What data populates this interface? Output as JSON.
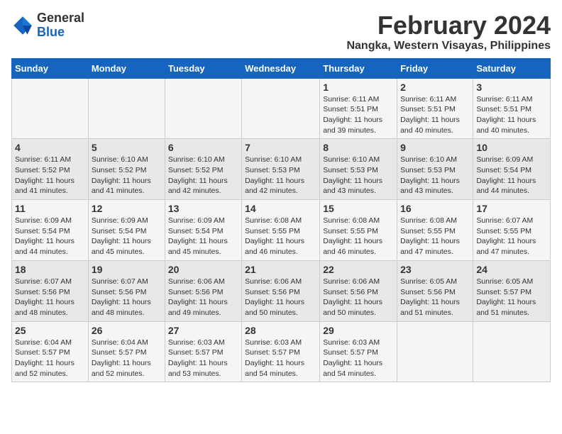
{
  "logo": {
    "general": "General",
    "blue": "Blue"
  },
  "header": {
    "title": "February 2024",
    "location": "Nangka, Western Visayas, Philippines"
  },
  "days_of_week": [
    "Sunday",
    "Monday",
    "Tuesday",
    "Wednesday",
    "Thursday",
    "Friday",
    "Saturday"
  ],
  "weeks": [
    [
      {
        "day": "",
        "info": ""
      },
      {
        "day": "",
        "info": ""
      },
      {
        "day": "",
        "info": ""
      },
      {
        "day": "",
        "info": ""
      },
      {
        "day": "1",
        "info": "Sunrise: 6:11 AM\nSunset: 5:51 PM\nDaylight: 11 hours and 39 minutes."
      },
      {
        "day": "2",
        "info": "Sunrise: 6:11 AM\nSunset: 5:51 PM\nDaylight: 11 hours and 40 minutes."
      },
      {
        "day": "3",
        "info": "Sunrise: 6:11 AM\nSunset: 5:51 PM\nDaylight: 11 hours and 40 minutes."
      }
    ],
    [
      {
        "day": "4",
        "info": "Sunrise: 6:11 AM\nSunset: 5:52 PM\nDaylight: 11 hours and 41 minutes."
      },
      {
        "day": "5",
        "info": "Sunrise: 6:10 AM\nSunset: 5:52 PM\nDaylight: 11 hours and 41 minutes."
      },
      {
        "day": "6",
        "info": "Sunrise: 6:10 AM\nSunset: 5:52 PM\nDaylight: 11 hours and 42 minutes."
      },
      {
        "day": "7",
        "info": "Sunrise: 6:10 AM\nSunset: 5:53 PM\nDaylight: 11 hours and 42 minutes."
      },
      {
        "day": "8",
        "info": "Sunrise: 6:10 AM\nSunset: 5:53 PM\nDaylight: 11 hours and 43 minutes."
      },
      {
        "day": "9",
        "info": "Sunrise: 6:10 AM\nSunset: 5:53 PM\nDaylight: 11 hours and 43 minutes."
      },
      {
        "day": "10",
        "info": "Sunrise: 6:09 AM\nSunset: 5:54 PM\nDaylight: 11 hours and 44 minutes."
      }
    ],
    [
      {
        "day": "11",
        "info": "Sunrise: 6:09 AM\nSunset: 5:54 PM\nDaylight: 11 hours and 44 minutes."
      },
      {
        "day": "12",
        "info": "Sunrise: 6:09 AM\nSunset: 5:54 PM\nDaylight: 11 hours and 45 minutes."
      },
      {
        "day": "13",
        "info": "Sunrise: 6:09 AM\nSunset: 5:54 PM\nDaylight: 11 hours and 45 minutes."
      },
      {
        "day": "14",
        "info": "Sunrise: 6:08 AM\nSunset: 5:55 PM\nDaylight: 11 hours and 46 minutes."
      },
      {
        "day": "15",
        "info": "Sunrise: 6:08 AM\nSunset: 5:55 PM\nDaylight: 11 hours and 46 minutes."
      },
      {
        "day": "16",
        "info": "Sunrise: 6:08 AM\nSunset: 5:55 PM\nDaylight: 11 hours and 47 minutes."
      },
      {
        "day": "17",
        "info": "Sunrise: 6:07 AM\nSunset: 5:55 PM\nDaylight: 11 hours and 47 minutes."
      }
    ],
    [
      {
        "day": "18",
        "info": "Sunrise: 6:07 AM\nSunset: 5:56 PM\nDaylight: 11 hours and 48 minutes."
      },
      {
        "day": "19",
        "info": "Sunrise: 6:07 AM\nSunset: 5:56 PM\nDaylight: 11 hours and 48 minutes."
      },
      {
        "day": "20",
        "info": "Sunrise: 6:06 AM\nSunset: 5:56 PM\nDaylight: 11 hours and 49 minutes."
      },
      {
        "day": "21",
        "info": "Sunrise: 6:06 AM\nSunset: 5:56 PM\nDaylight: 11 hours and 50 minutes."
      },
      {
        "day": "22",
        "info": "Sunrise: 6:06 AM\nSunset: 5:56 PM\nDaylight: 11 hours and 50 minutes."
      },
      {
        "day": "23",
        "info": "Sunrise: 6:05 AM\nSunset: 5:56 PM\nDaylight: 11 hours and 51 minutes."
      },
      {
        "day": "24",
        "info": "Sunrise: 6:05 AM\nSunset: 5:57 PM\nDaylight: 11 hours and 51 minutes."
      }
    ],
    [
      {
        "day": "25",
        "info": "Sunrise: 6:04 AM\nSunset: 5:57 PM\nDaylight: 11 hours and 52 minutes."
      },
      {
        "day": "26",
        "info": "Sunrise: 6:04 AM\nSunset: 5:57 PM\nDaylight: 11 hours and 52 minutes."
      },
      {
        "day": "27",
        "info": "Sunrise: 6:03 AM\nSunset: 5:57 PM\nDaylight: 11 hours and 53 minutes."
      },
      {
        "day": "28",
        "info": "Sunrise: 6:03 AM\nSunset: 5:57 PM\nDaylight: 11 hours and 54 minutes."
      },
      {
        "day": "29",
        "info": "Sunrise: 6:03 AM\nSunset: 5:57 PM\nDaylight: 11 hours and 54 minutes."
      },
      {
        "day": "",
        "info": ""
      },
      {
        "day": "",
        "info": ""
      }
    ]
  ]
}
